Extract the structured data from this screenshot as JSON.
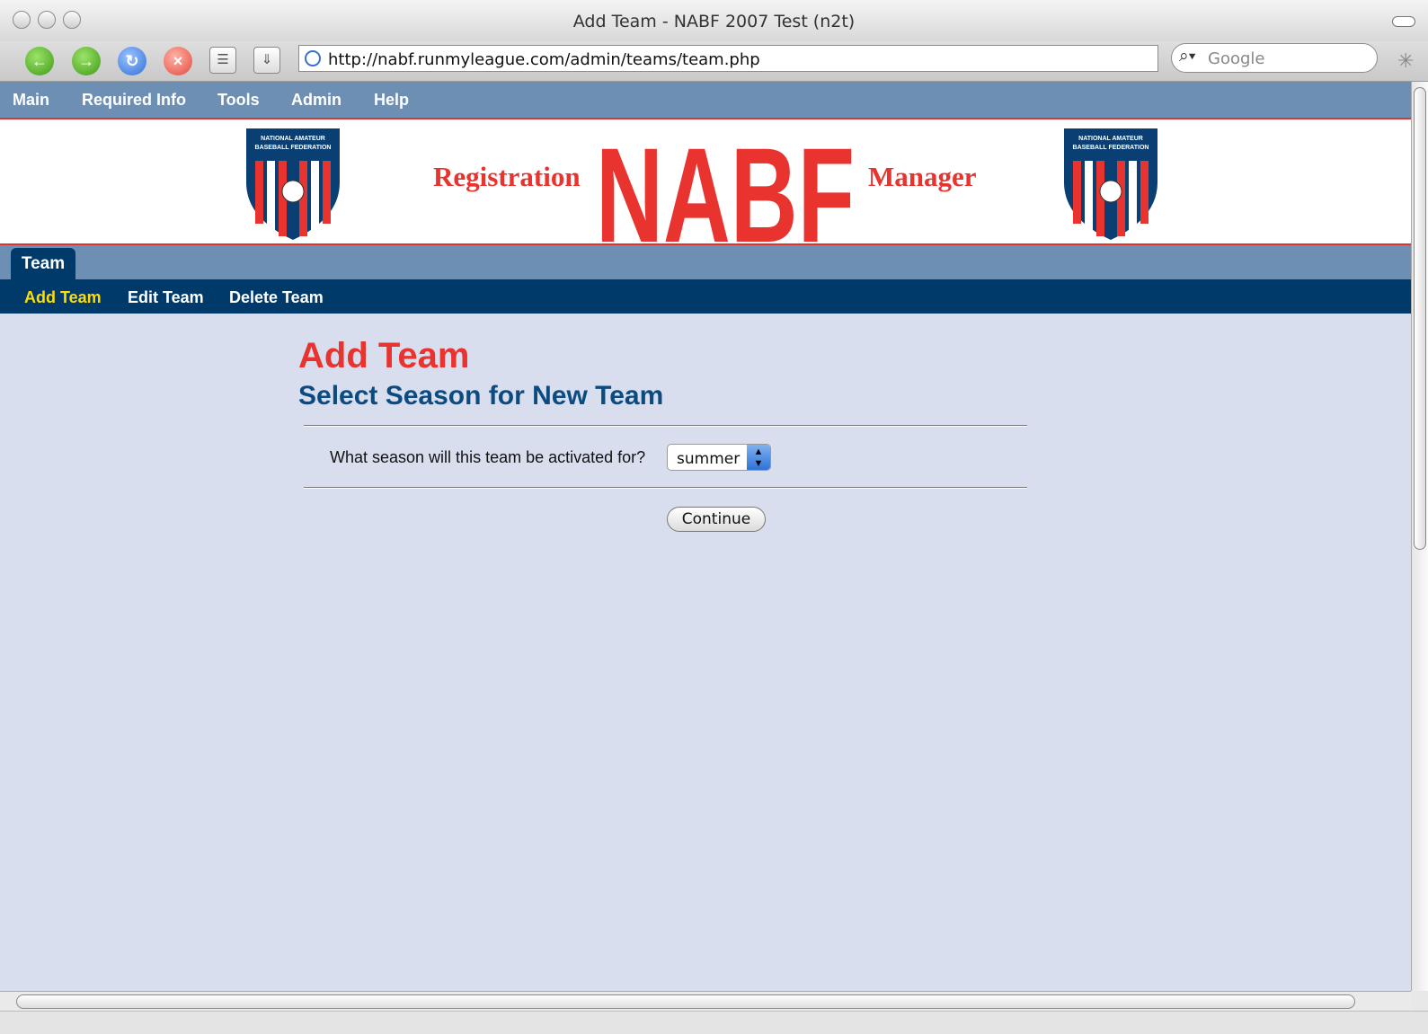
{
  "window": {
    "title": "Add Team - NABF 2007 Test (n2t)"
  },
  "toolbar": {
    "url": "http://nabf.runmyleague.com/admin/teams/team.php",
    "search_placeholder": "Google"
  },
  "topnav": [
    "Main",
    "Required Info",
    "Tools",
    "Admin",
    "Help"
  ],
  "banner": {
    "left_word": "Registration",
    "right_word": "Manager",
    "shield_text_line1": "NATIONAL AMATEUR",
    "shield_text_line2": "BASEBALL FEDERATION",
    "logo_text": "NABF"
  },
  "tabs": {
    "active": "Team"
  },
  "subnav": [
    "Add Team",
    "Edit Team",
    "Delete Team"
  ],
  "main": {
    "title": "Add Team",
    "subtitle": "Select Season for New Team",
    "question": "What season will this team be activated for?",
    "season_value": "summer",
    "continue_label": "Continue"
  },
  "colors": {
    "nav_bg": "#6d8fb3",
    "subnav_bg": "#003a6b",
    "accent_red": "#e8332e",
    "active_yellow": "#ffdd00",
    "page_bg": "#d8deee"
  }
}
